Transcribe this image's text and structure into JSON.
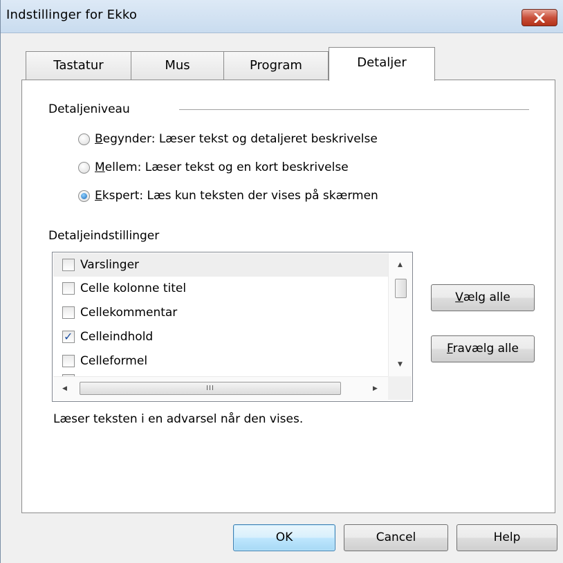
{
  "window": {
    "title": "Indstillinger for Ekko",
    "close_label": "close"
  },
  "tabs": [
    {
      "label": "Tastatur",
      "active": false
    },
    {
      "label": "Mus",
      "active": false
    },
    {
      "label": "Program",
      "active": false
    },
    {
      "label": "Detaljer",
      "active": true
    }
  ],
  "detail_level": {
    "label": "Detaljeniveau",
    "options": [
      {
        "accel": "B",
        "rest": "egynder: Læser tekst og detaljeret beskrivelse",
        "checked": false
      },
      {
        "accel": "M",
        "rest": "ellem: Læser tekst og en kort beskrivelse",
        "checked": false
      },
      {
        "accel": "E",
        "rest": "kspert: Læs kun teksten der vises på skærmen",
        "checked": true
      }
    ]
  },
  "detail_settings": {
    "label": "Detaljeindstillinger",
    "items": [
      {
        "label": "Varslinger",
        "checked": false,
        "selected": true
      },
      {
        "label": "Celle kolonne titel",
        "checked": false,
        "selected": false
      },
      {
        "label": "Cellekommentar",
        "checked": false,
        "selected": false
      },
      {
        "label": "Celleindhold",
        "checked": true,
        "selected": false
      },
      {
        "label": "Celleformel",
        "checked": false,
        "selected": false
      }
    ],
    "hscroll_grip": "III"
  },
  "side_buttons": {
    "select_all": {
      "accel": "V",
      "rest": "ælg alle"
    },
    "deselect_all": {
      "accel": "F",
      "rest": "ravælg alle"
    }
  },
  "description": "Læser teksten i en advarsel når den vises.",
  "footer": {
    "ok_label": "OK",
    "cancel_label": "Cancel",
    "help_label": "Help"
  },
  "colors": {
    "titlebar": "#c9dcef",
    "close_button": "#c9503b",
    "checkmark": "#1d4fa0",
    "default_button_border": "#3c7fb1"
  }
}
